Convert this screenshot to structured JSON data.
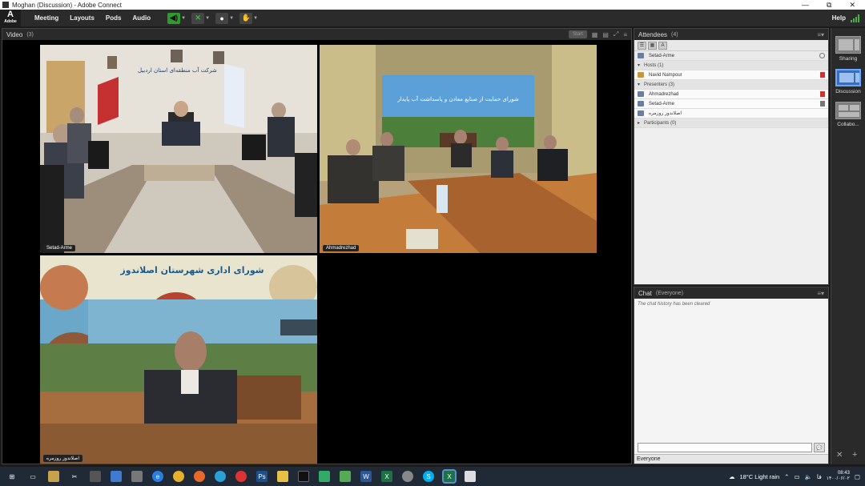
{
  "window": {
    "title": "Moghan (Discussion) - Adobe Connect",
    "controls": [
      "—",
      "⧉",
      "✕"
    ]
  },
  "menubar": {
    "logo": "A",
    "logo_sub": "Adobe",
    "items": [
      "Meeting",
      "Layouts",
      "Pods",
      "Audio"
    ],
    "help": "Help"
  },
  "video_pod": {
    "title": "Video",
    "count": "(3)",
    "start_label": "Start",
    "tiles": [
      {
        "name": "Setad-Arme",
        "sign_text": "شرکت آب منطقه‌ای استان اردبیل"
      },
      {
        "name": "Ahmadrezhad",
        "banner_text": "شورای حمایت از صنایع معادن و پاسداشت آب پایدار"
      },
      {
        "name": "اصلاندوز روزمره",
        "banner_text": "شورای اداری شهرستان اصلاندوز"
      }
    ]
  },
  "attendees_pod": {
    "title": "Attendees",
    "count": "(4)",
    "me": "Setad-Arme",
    "sections": [
      {
        "label": "Hosts (1)",
        "people": [
          "Navid Nampour"
        ]
      },
      {
        "label": "Presenters (3)",
        "people": [
          "Ahmadrezhad",
          "Setad-Arme",
          "اصلاندوز روزمره"
        ]
      },
      {
        "label": "Participants (0)",
        "people": []
      }
    ]
  },
  "chat_pod": {
    "title": "Chat",
    "scope": "(Everyone)",
    "message": "The chat history has been cleared",
    "recipient": "Everyone"
  },
  "layouts_bar": [
    {
      "label": "Sharing"
    },
    {
      "label": "Discussion"
    },
    {
      "label": "Collabo..."
    }
  ],
  "taskbar": {
    "weather": "18°C Light rain",
    "time": "08:43",
    "date": "۱۴۰۰/۰۶/۰۲",
    "lang": "فا"
  },
  "colors": {
    "accent": "#3b6fb5",
    "mic_green": "#2f9b2f",
    "chrome": "#2b2b2b"
  }
}
